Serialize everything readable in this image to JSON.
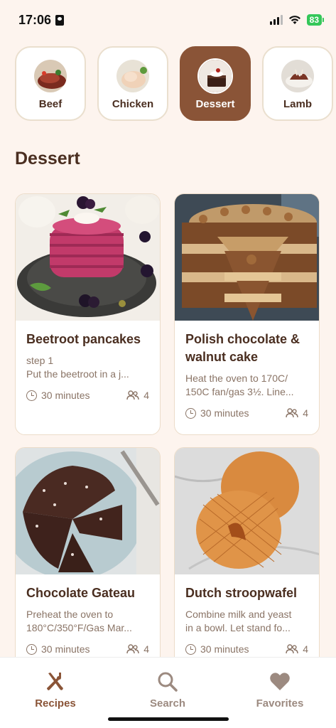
{
  "status": {
    "time": "17:06",
    "battery": "83"
  },
  "categories": [
    {
      "label": "Beef",
      "active": false
    },
    {
      "label": "Chicken",
      "active": false
    },
    {
      "label": "Dessert",
      "active": true
    },
    {
      "label": "Lamb",
      "active": false
    }
  ],
  "section_title": "Dessert",
  "recipes": [
    {
      "title": "Beetroot pancakes",
      "desc_line1": "step 1",
      "desc_line2": "Put the beetroot in a j...",
      "time": "30 minutes",
      "servings": "4"
    },
    {
      "title_line1": "Polish chocolate &",
      "title_line2": "walnut cake",
      "desc_line1": "Heat the oven to 170C/",
      "desc_line2": "150C fan/gas 3½. Line...",
      "time": "30 minutes",
      "servings": "4"
    },
    {
      "title": "Chocolate Gateau",
      "desc_line1": "Preheat the oven to",
      "desc_line2": "180°C/350°F/Gas Mar...",
      "time": "30 minutes",
      "servings": "4"
    },
    {
      "title": "Dutch stroopwafel",
      "desc_line1": "Combine milk and yeast",
      "desc_line2": "in a bowl. Let stand fo...",
      "time": "30 minutes",
      "servings": "4"
    }
  ],
  "nav": {
    "recipes": "Recipes",
    "search": "Search",
    "favorites": "Favorites"
  },
  "colors": {
    "accent": "#8a5437",
    "background": "#fdf4ee",
    "inactive_nav": "#9c8a80"
  },
  "icons": [
    "cutlery-icon",
    "search-icon",
    "heart-icon",
    "clock-icon",
    "people-icon"
  ]
}
